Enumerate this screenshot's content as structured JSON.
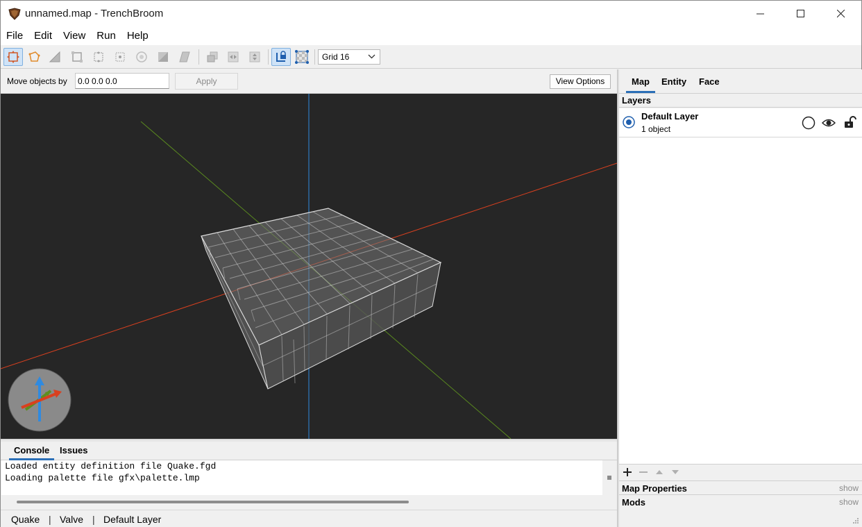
{
  "window": {
    "title": "unnamed.map - TrenchBroom"
  },
  "menu": [
    "File",
    "Edit",
    "View",
    "Run",
    "Help"
  ],
  "toolbar": {
    "grid_select": "Grid 16",
    "tools": [
      "move-tool-icon",
      "rotate-tool-icon",
      "scale-tool-icon",
      "shear-tool-icon",
      "edge-tool-icon",
      "vertex-tool-icon",
      "face-tool-icon",
      "clip-tool-icon",
      "duplicate-icon",
      "flip-horizontal-icon",
      "flip-vertical-icon",
      "texture-lock-icon",
      "uv-lock-icon"
    ]
  },
  "move_bar": {
    "label": "Move objects by",
    "value": "0.0 0.0 0.0",
    "apply": "Apply",
    "view_options": "View Options"
  },
  "console": {
    "tabs": [
      "Console",
      "Issues"
    ],
    "lines": [
      "Loaded entity definition file Quake.fgd",
      "Loading palette file gfx\\palette.lmp"
    ]
  },
  "status": [
    "Quake",
    "Valve",
    "Default Layer"
  ],
  "status_separator": "|",
  "right_panel": {
    "tabs": [
      "Map",
      "Entity",
      "Face"
    ],
    "layers_title": "Layers",
    "layer": {
      "name": "Default Layer",
      "count": "1 object"
    },
    "map_properties": "Map Properties",
    "mods": "Mods",
    "show": "show"
  },
  "colors": {
    "accent": "#2b6fb7",
    "viewport": "#262626",
    "x_axis": "#d9401f",
    "y_axis": "#5a8a1f",
    "z_axis": "#2f8ae0"
  }
}
